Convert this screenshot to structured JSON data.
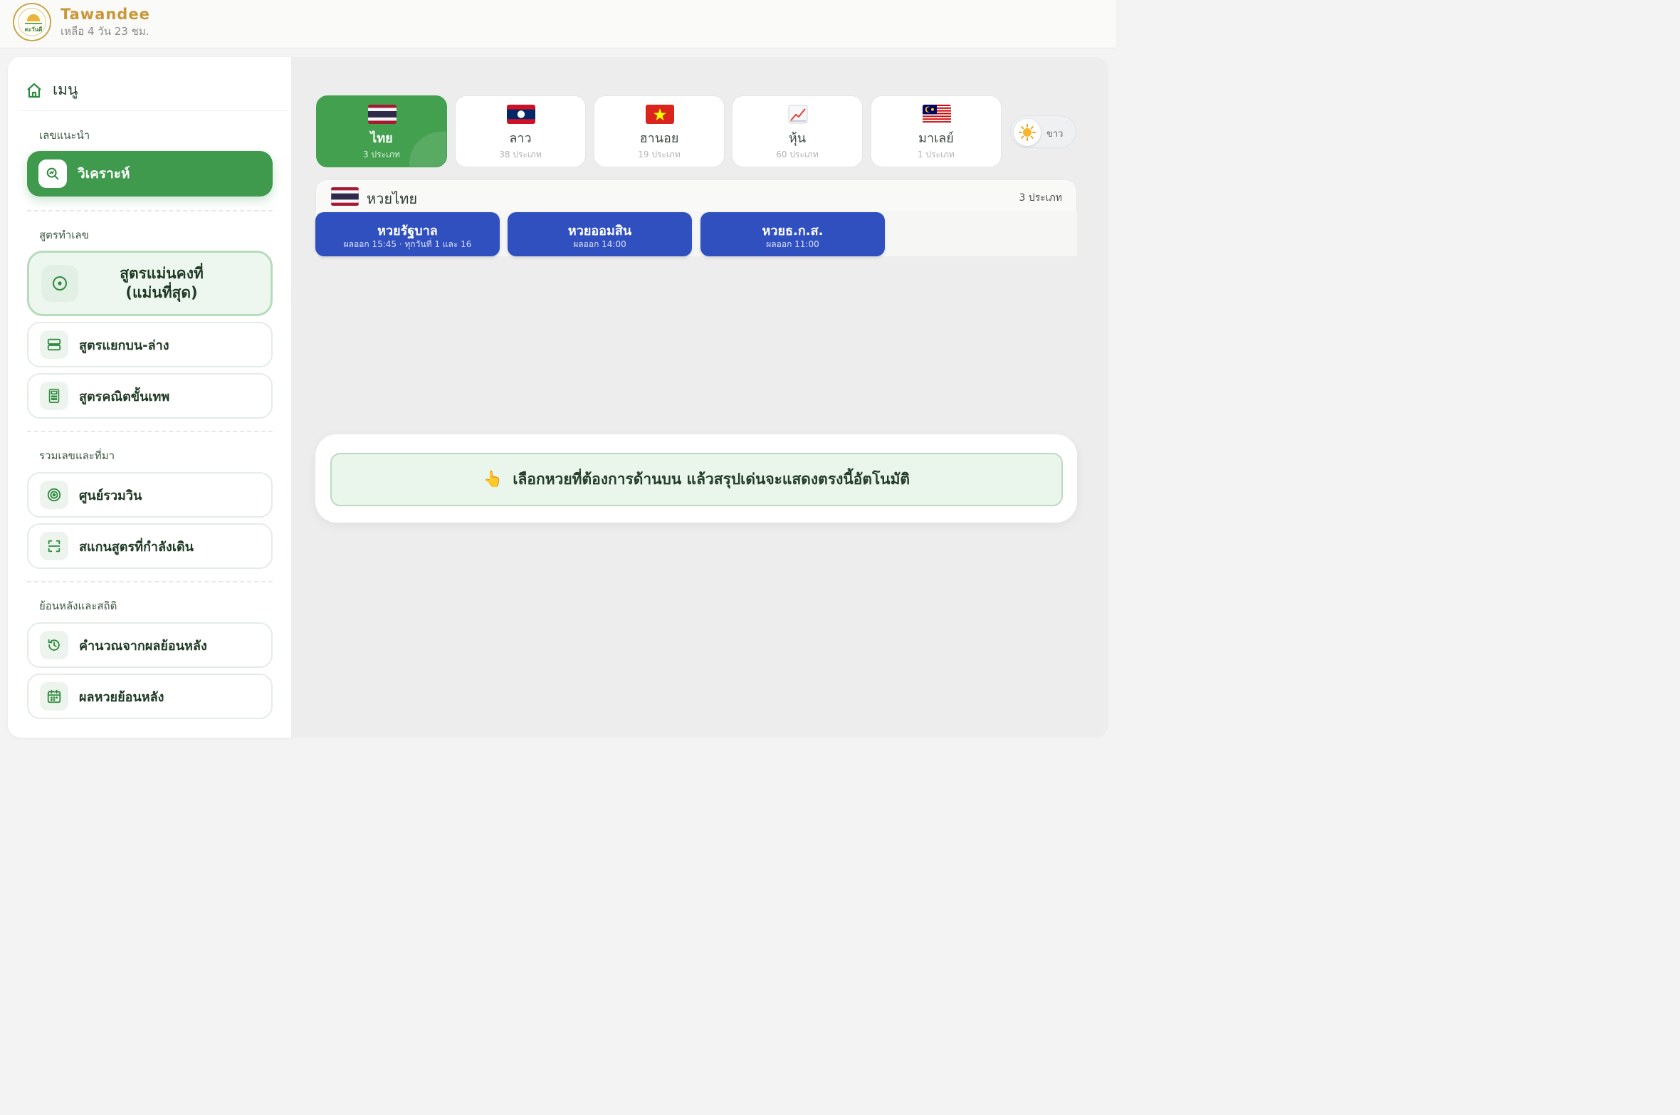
{
  "header": {
    "logo_text": "ตะวันดี",
    "brand": "Tawandee",
    "countdown": "เหลือ 4 วัน 23 ชม."
  },
  "sidebar": {
    "menu_title": "เมนู",
    "sections": [
      {
        "label": "เลขแนะนำ"
      },
      {
        "label": "สูตรทำเลข"
      },
      {
        "label": "รวมเลขและที่มา"
      },
      {
        "label": "ย้อนหลังและสถิติ"
      }
    ],
    "items": {
      "analyze": "วิเคราะห์",
      "stable_line1": "สูตรแม่นคงที่",
      "stable_line2": "(แม่นที่สุด)",
      "split": "สูตรแยกบน-ล่าง",
      "math": "สูตรคณิตขั้นเทพ",
      "win_center": "ศูนย์รวมวิน",
      "scan": "สแกนสูตรที่กำลังเดิน",
      "calc_history": "คำนวณจากผลย้อนหลัง",
      "past_results": "ผลหวยย้อนหลัง"
    }
  },
  "countries": [
    {
      "name": "ไทย",
      "count": "3 ประเภท",
      "icon": "thai-flag-icon"
    },
    {
      "name": "ลาว",
      "count": "38 ประเภท",
      "icon": "lao-flag-icon"
    },
    {
      "name": "ฮานอย",
      "count": "19 ประเภท",
      "icon": "vietnam-flag-icon"
    },
    {
      "name": "หุ้น",
      "count": "60 ประเภท",
      "icon": "stock-chart-icon"
    },
    {
      "name": "มาเลย์",
      "count": "1 ประเภท",
      "icon": "malaysia-flag-icon"
    }
  ],
  "theme_toggle": {
    "label": "ขาว",
    "icon": "sun-icon"
  },
  "group": {
    "name": "หวยไทย",
    "count": "3 ประเภท"
  },
  "lotteries": [
    {
      "name": "หวยรัฐบาล",
      "time": "ผลออก 15:45 · ทุกวันที่ 1 และ 16"
    },
    {
      "name": "หวยออมสิน",
      "time": "ผลออก 14:00"
    },
    {
      "name": "หวยธ.ก.ส.",
      "time": "ผลออก 11:00"
    }
  ],
  "hint": {
    "icon": "👆",
    "text": "เลือกหวยที่ต้องการด้านบน แล้วสรุปเด่นจะแสดงตรงนี้อัตโนมัติ"
  },
  "colors": {
    "accent_green": "#43a04f",
    "lotto_blue": "#3150c0",
    "brand_gold": "#c9973a"
  }
}
